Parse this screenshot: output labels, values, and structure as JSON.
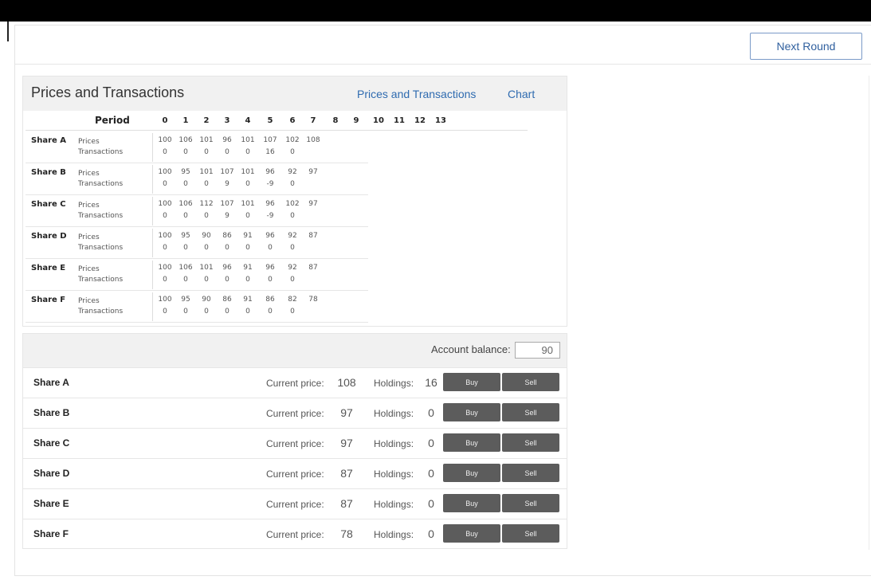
{
  "next_button_label": "Next Round",
  "pt": {
    "title": "Prices and Transactions",
    "tabs": [
      "Prices and Transactions",
      "Chart"
    ],
    "period_label": "Period",
    "periods": [
      "0",
      "1",
      "2",
      "3",
      "4",
      "5",
      "6",
      "7",
      "8",
      "9",
      "10",
      "11",
      "12",
      "13"
    ],
    "row_labels": {
      "prices": "Prices",
      "transactions": "Transactions"
    },
    "shares": [
      {
        "name": "Share A",
        "prices": [
          "100",
          "106",
          "101",
          "96",
          "101",
          "107",
          "102",
          "108"
        ],
        "transactions": [
          "0",
          "0",
          "0",
          "0",
          "0",
          "16",
          "0"
        ]
      },
      {
        "name": "Share B",
        "prices": [
          "100",
          "95",
          "101",
          "107",
          "101",
          "96",
          "92",
          "97"
        ],
        "transactions": [
          "0",
          "0",
          "0",
          "9",
          "0",
          "-9",
          "0"
        ]
      },
      {
        "name": "Share C",
        "prices": [
          "100",
          "106",
          "112",
          "107",
          "101",
          "96",
          "102",
          "97"
        ],
        "transactions": [
          "0",
          "0",
          "0",
          "9",
          "0",
          "-9",
          "0"
        ]
      },
      {
        "name": "Share D",
        "prices": [
          "100",
          "95",
          "90",
          "86",
          "91",
          "96",
          "92",
          "87"
        ],
        "transactions": [
          "0",
          "0",
          "0",
          "0",
          "0",
          "0",
          "0"
        ]
      },
      {
        "name": "Share E",
        "prices": [
          "100",
          "106",
          "101",
          "96",
          "91",
          "96",
          "92",
          "87"
        ],
        "transactions": [
          "0",
          "0",
          "0",
          "0",
          "0",
          "0",
          "0"
        ]
      },
      {
        "name": "Share F",
        "prices": [
          "100",
          "95",
          "90",
          "86",
          "91",
          "86",
          "82",
          "78"
        ],
        "transactions": [
          "0",
          "0",
          "0",
          "0",
          "0",
          "0",
          "0"
        ]
      }
    ]
  },
  "trade": {
    "balance_label": "Account balance:",
    "balance": "90",
    "current_price_label": "Current price:",
    "holdings_label": "Holdings:",
    "buy_label": "Buy",
    "sell_label": "Sell",
    "rows": [
      {
        "name": "Share A",
        "price": "108",
        "holdings": "16"
      },
      {
        "name": "Share B",
        "price": "97",
        "holdings": "0"
      },
      {
        "name": "Share C",
        "price": "97",
        "holdings": "0"
      },
      {
        "name": "Share D",
        "price": "87",
        "holdings": "0"
      },
      {
        "name": "Share E",
        "price": "87",
        "holdings": "0"
      },
      {
        "name": "Share F",
        "price": "78",
        "holdings": "0"
      }
    ]
  }
}
